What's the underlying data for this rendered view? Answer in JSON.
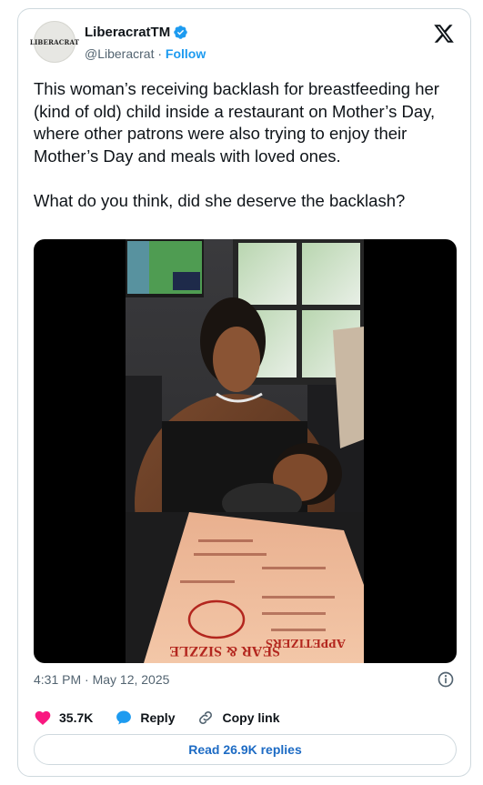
{
  "author": {
    "display_name": "LiberacratTM",
    "handle": "@Liberacrat",
    "separator": "·",
    "follow_label": "Follow",
    "avatar_text": "LIBERACRAT",
    "verified_color": "#1d9bf0",
    "avatar_icon": "liberacrat-logo-icon"
  },
  "tweet": {
    "text": "This woman’s receiving backlash for breastfeeding her (kind of old) child inside a restaurant on Mother’s Day, where other patrons were also trying to enjoy their Mother’s Day and meals with loved ones.\n\nWhat do you think, did she deserve the backlash?",
    "timestamp": "4:31 PM · May 12, 2025"
  },
  "media": {
    "menu_text_left": "SEAR & SIZZLE",
    "menu_text_right": "APPETIZERS"
  },
  "actions": {
    "like_count": "35.7K",
    "reply_label": "Reply",
    "copy_label": "Copy link",
    "like_color": "#f91880",
    "reply_color": "#1d9bf0"
  },
  "replies_button": {
    "label": "Read 26.9K replies"
  },
  "brand": {
    "logo": "x-logo-icon",
    "accent": "#1d9bf0"
  }
}
